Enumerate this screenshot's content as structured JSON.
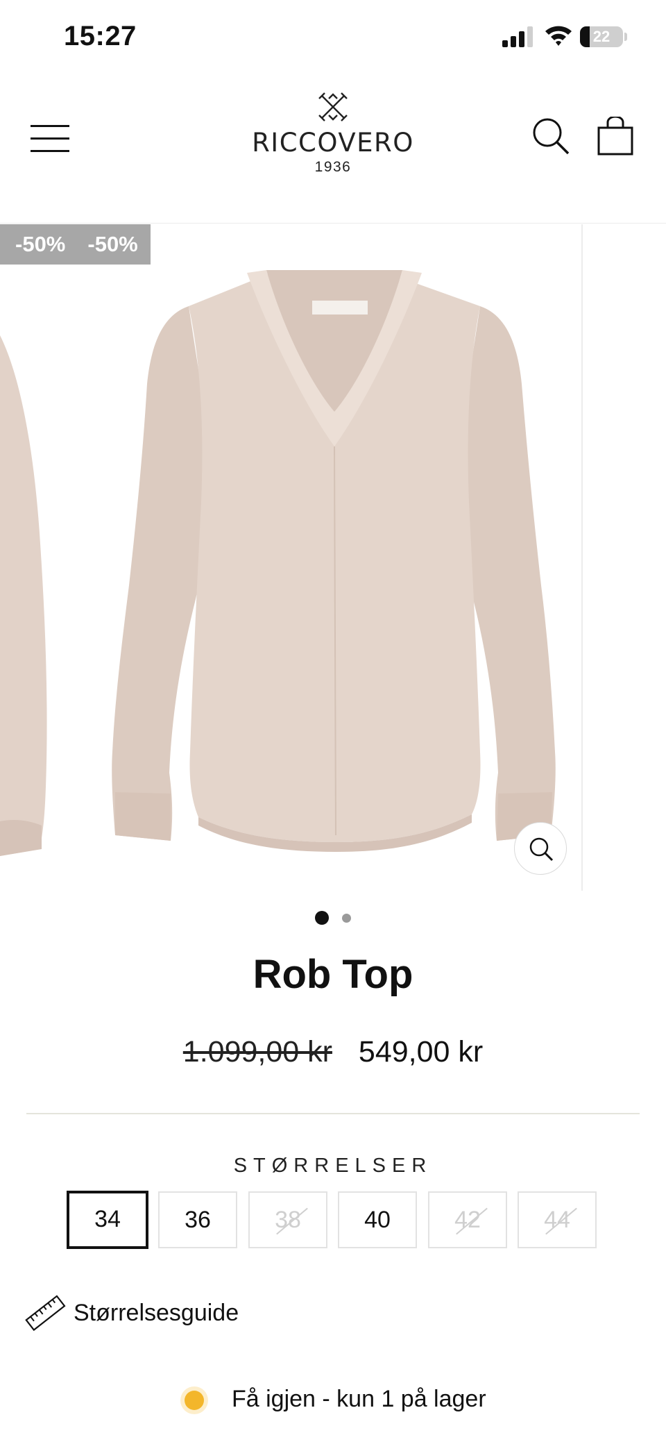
{
  "status_bar": {
    "time": "15:27",
    "battery_percent": 22,
    "battery_label": "22",
    "icons": [
      "signal-icon",
      "wifi-icon",
      "battery-icon"
    ]
  },
  "header": {
    "logo_name": "RICCOVERO",
    "logo_year": "1936",
    "icons": [
      "menu-icon",
      "search-icon",
      "shopping-bag-icon"
    ]
  },
  "gallery": {
    "badges": [
      "-50%",
      "-50%"
    ],
    "active_slide": 1,
    "slide_count": 2,
    "zoom_icon": "zoom-icon"
  },
  "product": {
    "title": "Rob Top",
    "old_price": "1.099,00 kr",
    "price": "549,00 kr"
  },
  "sizes": {
    "label": "STØRRELSER",
    "options": [
      {
        "label": "34",
        "state": "selected"
      },
      {
        "label": "36",
        "state": "available"
      },
      {
        "label": "38",
        "state": "unavailable"
      },
      {
        "label": "40",
        "state": "available"
      },
      {
        "label": "42",
        "state": "unavailable"
      },
      {
        "label": "44",
        "state": "unavailable"
      }
    ]
  },
  "size_guide": {
    "label": "Størrelsesguide",
    "icon": "ruler-icon"
  },
  "stock": {
    "text": "Få igjen - kun 1 på lager",
    "status_color": "#f3b62b"
  },
  "colors": {
    "garment": "#e3d3ca",
    "badge_bg": "#a7a7a7",
    "text": "#111111"
  }
}
